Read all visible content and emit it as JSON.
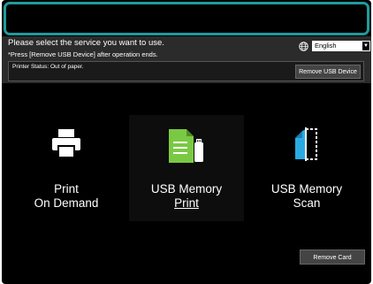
{
  "header": {
    "instruction": "Please select the service you want to use.",
    "note": "*Press [Remove USB Device] after operation ends.",
    "language": {
      "selected": "English"
    },
    "status": "Printer Status: Out of paper.",
    "remove_usb_label": "Remove USB Device"
  },
  "services": [
    {
      "line1": "Print",
      "line2": "On Demand",
      "icon": "printer-icon"
    },
    {
      "line1": "USB Memory",
      "line2": "Print",
      "icon": "usb-document-icon"
    },
    {
      "line1": "USB Memory",
      "line2": "Scan",
      "icon": "scan-icon"
    }
  ],
  "remove_card_label": "Remove Card",
  "colors": {
    "accent": "#1f9a9d",
    "icon_green": "#7ac943",
    "icon_blue": "#29abe2"
  }
}
